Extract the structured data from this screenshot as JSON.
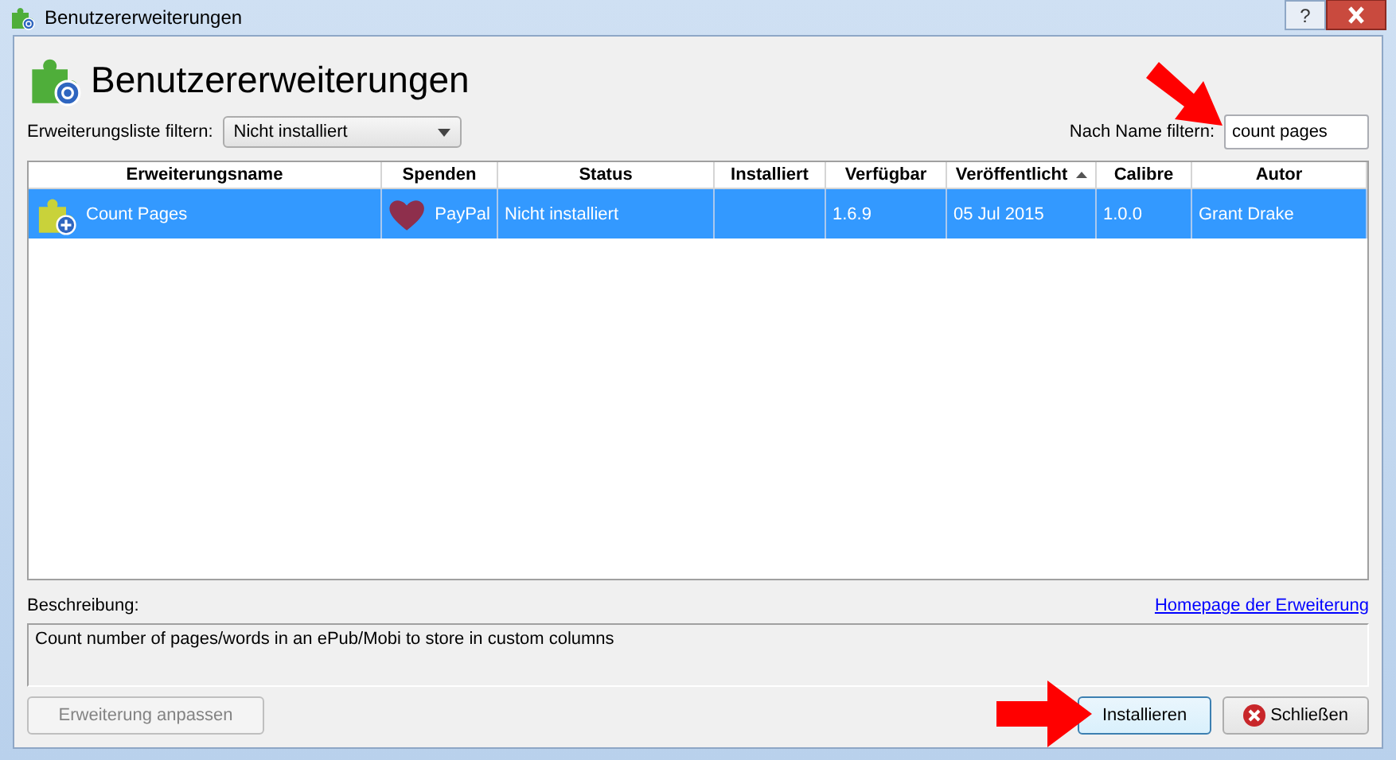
{
  "window": {
    "title": "Benutzererweiterungen",
    "help": "?"
  },
  "heading": "Benutzererweiterungen",
  "filter": {
    "label": "Erweiterungsliste filtern:",
    "value": "Nicht installiert"
  },
  "name_filter": {
    "label": "Nach Name filtern:",
    "value": "count pages"
  },
  "table": {
    "columns": [
      {
        "label": "Erweiterungsname",
        "sorted": false
      },
      {
        "label": "Spenden",
        "sorted": false
      },
      {
        "label": "Status",
        "sorted": false
      },
      {
        "label": "Installiert",
        "sorted": false
      },
      {
        "label": "Verfügbar",
        "sorted": false
      },
      {
        "label": "Veröffentlicht",
        "sorted": true
      },
      {
        "label": "Calibre",
        "sorted": false
      },
      {
        "label": "Autor",
        "sorted": false
      }
    ],
    "rows": [
      {
        "selected": true,
        "name": "Count Pages",
        "donate": "PayPal",
        "status": "Nicht installiert",
        "available": "1.6.9",
        "released": "05 Jul 2015",
        "calibre": "1.0.0",
        "author": "Grant Drake"
      }
    ]
  },
  "description": {
    "label": "Beschreibung:",
    "link": "Homepage der Erweiterung",
    "text": "Count number of pages/words in an ePub/Mobi to store in custom columns"
  },
  "buttons": [
    {
      "label": "Erweiterung anpassen",
      "disabled": true,
      "kind": "plain"
    },
    {
      "label": "Installieren",
      "disabled": false,
      "kind": "default"
    },
    {
      "label": "Schließen",
      "disabled": false,
      "kind": "close"
    }
  ]
}
